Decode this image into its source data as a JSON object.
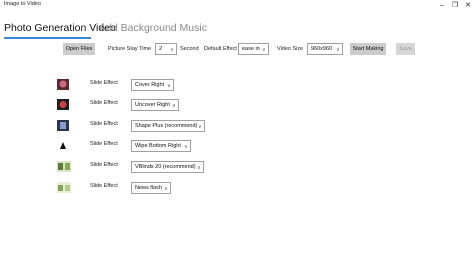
{
  "window": {
    "title": "Image to Video",
    "minimize_icon": "minimize-icon",
    "maximize_icon": "restore-icon",
    "close_icon": "close-icon"
  },
  "tabs": [
    {
      "label": "Photo Generation Video"
    },
    {
      "label": "Add Background Music"
    }
  ],
  "toolbar": {
    "open_files": "Open Files",
    "stay_time_label": "Picture Stay Time",
    "stay_time_value": "2",
    "second_label": "Second",
    "default_effect_label": "Default Effect",
    "default_effect_value": "ease in",
    "video_size_label": "Video Size",
    "video_size_value": "960x960",
    "start_making": "Start Making",
    "save": "Save"
  },
  "rows": [
    {
      "label": "Slide Effect",
      "effect": "Cover Right",
      "thumb_color": "#7a3b4a"
    },
    {
      "label": "Slide Effect",
      "effect": "Uncover Right",
      "thumb_color": "#2b2b2b"
    },
    {
      "label": "Slide Effect",
      "effect": "Shape Plus (recommend)",
      "thumb_color": "#3d4a6b"
    },
    {
      "label": "Slide Effect",
      "effect": "Wipe Bottom Right",
      "thumb_color": "#1c1c1c"
    },
    {
      "label": "Slide Effect",
      "effect": "VBlinds 20 (recommend)",
      "thumb_color": "#6a8a4a"
    },
    {
      "label": "Slide Effect",
      "effect": "News flash",
      "thumb_color": "#9ab37a"
    }
  ],
  "colors": {
    "accent": "#3b87d6",
    "button": "#cccccc"
  }
}
